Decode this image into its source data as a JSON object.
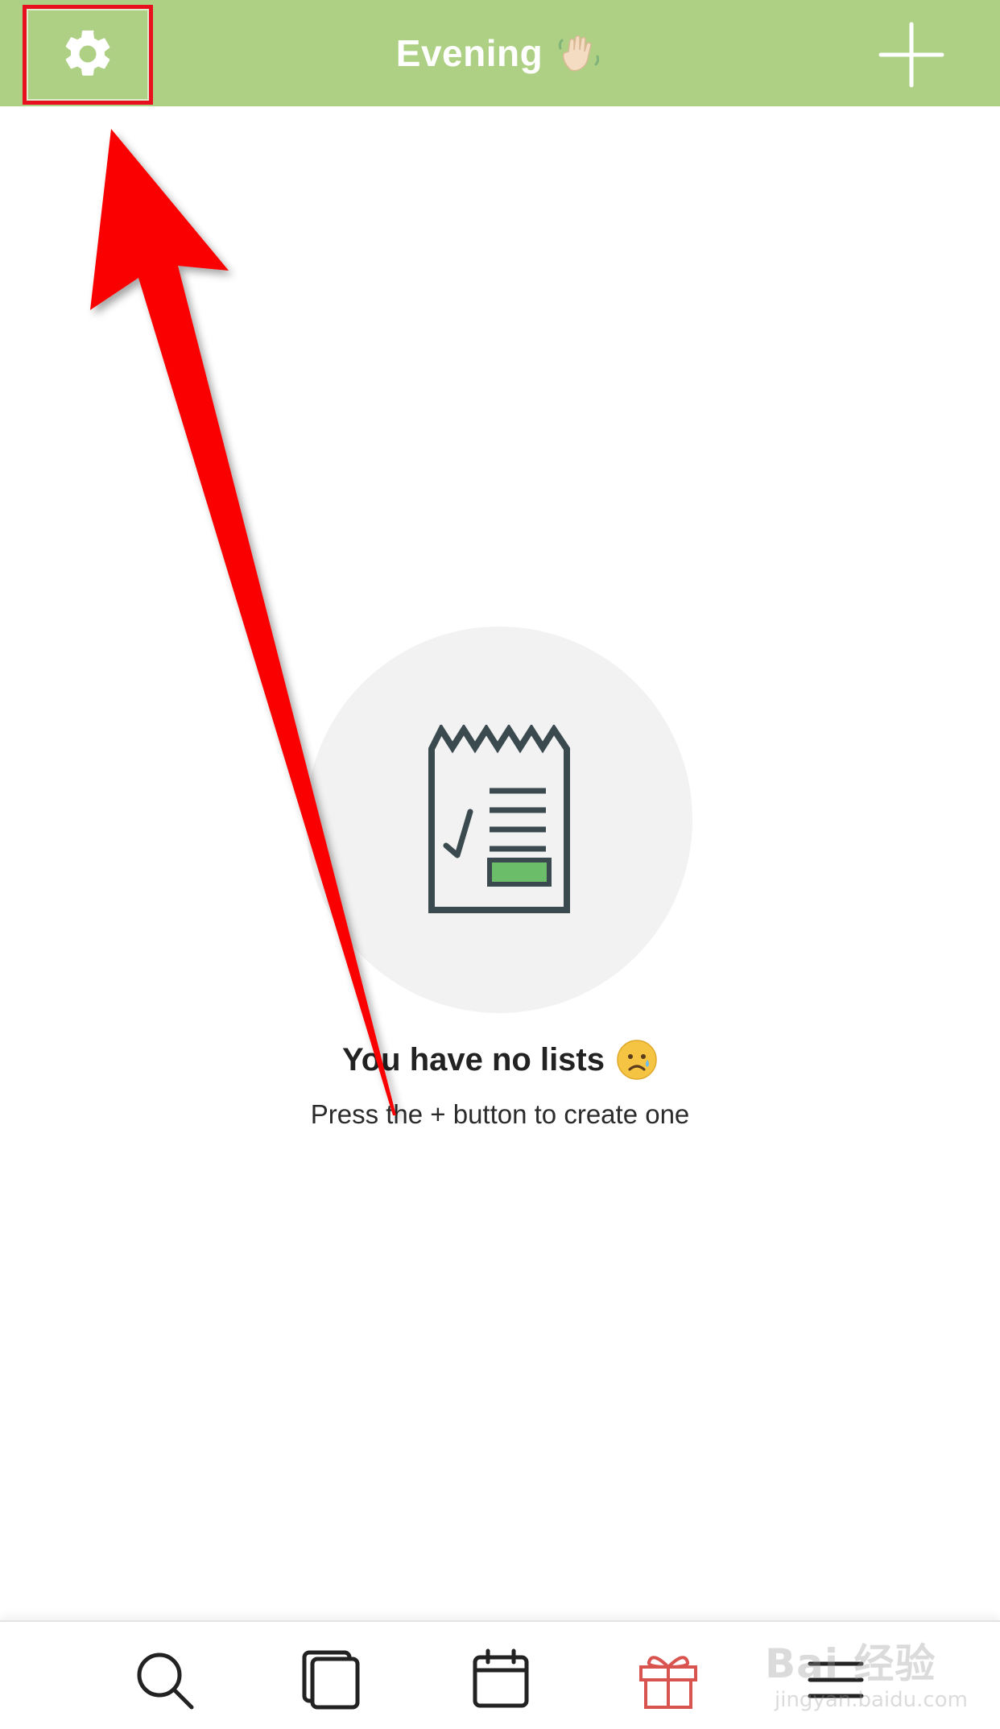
{
  "header": {
    "title": "Evening",
    "wave_icon": "waving-hand-icon",
    "left_icon": "gear-icon",
    "right_icon": "plus-icon",
    "background": "#aed084"
  },
  "empty_state": {
    "icon": "receipt-checklist-icon",
    "title": "You have no lists",
    "title_icon": "sad-face-icon",
    "subtitle": "Press the + button to create one"
  },
  "tabbar": {
    "tabs": [
      {
        "name": "search",
        "icon": "search-icon"
      },
      {
        "name": "lists",
        "icon": "copy-icon"
      },
      {
        "name": "calendar",
        "icon": "calendar-icon"
      },
      {
        "name": "gift",
        "icon": "gift-icon"
      },
      {
        "name": "menu",
        "icon": "menu-icon"
      }
    ]
  },
  "watermark": {
    "main": "Bai 经验",
    "sub": "jingyan.baidu.com"
  },
  "colors": {
    "accent": "#aed084",
    "annotation": "#e8101e",
    "icon_dark": "#3a4a4e",
    "gift": "#d9534f"
  }
}
